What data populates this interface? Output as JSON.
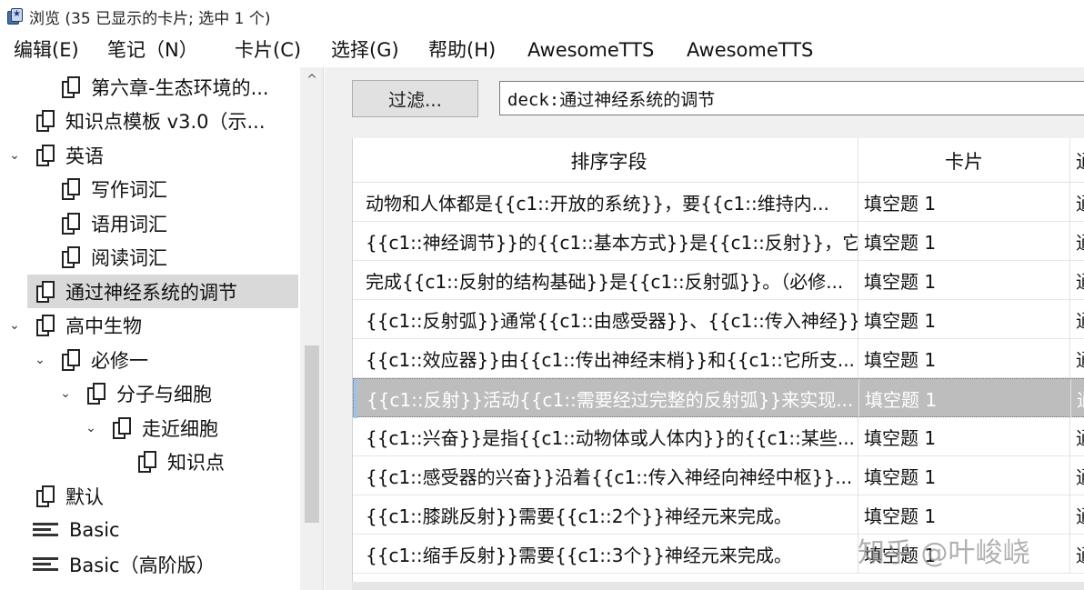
{
  "window": {
    "title": "浏览 (35 已显示的卡片; 选中 1 个)"
  },
  "menubar": {
    "items": [
      "编辑(E)",
      "笔记（N）",
      "卡片(C)",
      "选择(G)",
      "帮助(H)",
      "AwesomeTTS",
      "AwesomeTTS"
    ]
  },
  "sidebar": {
    "items": [
      {
        "label": "第六章-生态环境的...",
        "icon": "deck-icon",
        "chevron": ""
      },
      {
        "label": "知识点模板 v3.0（示...",
        "icon": "deck-icon",
        "chevron": ""
      },
      {
        "label": "英语",
        "icon": "deck-icon",
        "chevron": "chevron-down"
      },
      {
        "label": "写作词汇",
        "icon": "deck-icon",
        "chevron": ""
      },
      {
        "label": "语用词汇",
        "icon": "deck-icon",
        "chevron": ""
      },
      {
        "label": "阅读词汇",
        "icon": "deck-icon",
        "chevron": ""
      },
      {
        "label": "通过神经系统的调节",
        "icon": "deck-icon",
        "chevron": "",
        "selected": true
      },
      {
        "label": "高中生物",
        "icon": "deck-icon",
        "chevron": "chevron-down"
      },
      {
        "label": "必修一",
        "icon": "deck-icon",
        "chevron": "chevron-down"
      },
      {
        "label": "分子与细胞",
        "icon": "deck-icon",
        "chevron": "chevron-down"
      },
      {
        "label": "走近细胞",
        "icon": "deck-icon",
        "chevron": "chevron-down"
      },
      {
        "label": "知识点",
        "icon": "deck-icon",
        "chevron": ""
      },
      {
        "label": "默认",
        "icon": "deck-icon",
        "chevron": ""
      },
      {
        "label": "Basic",
        "icon": "note-type-icon",
        "chevron": ""
      },
      {
        "label": "Basic（高阶版）",
        "icon": "note-type-icon",
        "chevron": ""
      }
    ]
  },
  "toolbar": {
    "filter_label": "过滤...",
    "search_value": "deck:通过神经系统的调节"
  },
  "table": {
    "columns": [
      "排序字段",
      "卡片",
      "通"
    ],
    "rows": [
      {
        "sort_field": "动物和人体都是{{c1::开放的系统}}，要{{c1::维持内...",
        "card": "填空题 1",
        "extra": "通"
      },
      {
        "sort_field": "{{c1::神经调节}}的{{c1::基本方式}}是{{c1::反射}}，它...",
        "card": "填空题 1",
        "extra": "通"
      },
      {
        "sort_field": "完成{{c1::反射的结构基础}}是{{c1::反射弧}}。（必修...",
        "card": "填空题 1",
        "extra": "通"
      },
      {
        "sort_field": "{{c1::反射弧}}通常{{c1::由感受器}}、{{c1::传入神经}}...",
        "card": "填空题 1",
        "extra": "通"
      },
      {
        "sort_field": "{{c1::效应器}}由{{c1::传出神经末梢}}和{{c1::它所支...",
        "card": "填空题 1",
        "extra": "通"
      },
      {
        "sort_field": "{{c1::反射}}活动{{c1::需要经过完整的反射弧}}来实现...",
        "card": "填空题 1",
        "extra": "通",
        "selected": true
      },
      {
        "sort_field": "{{c1::兴奋}}是指{{c1::动物体或人体内}}的{{c1::某些...",
        "card": "填空题 1",
        "extra": "通"
      },
      {
        "sort_field": "{{c1::感受器的兴奋}}沿着{{c1::传入神经向神经中枢}}...",
        "card": "填空题 1",
        "extra": "通"
      },
      {
        "sort_field": "{{c1::膝跳反射}}需要{{c1::2个}}神经元来完成。",
        "card": "填空题 1",
        "extra": "通"
      },
      {
        "sort_field": "{{c1::缩手反射}}需要{{c1::3个}}神经元来完成。",
        "card": "填空题 1",
        "extra": "通"
      }
    ]
  },
  "watermark": "知乎 @叶峻峣"
}
